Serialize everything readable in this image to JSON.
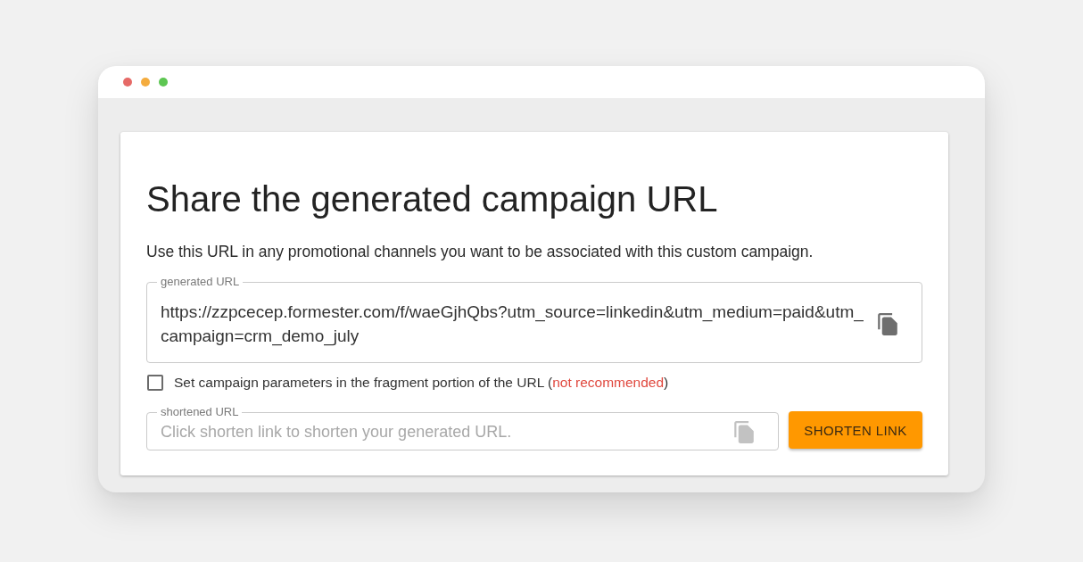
{
  "window": {
    "buttons": [
      {
        "color": "#e66a67"
      },
      {
        "color": "#f4ac3f"
      },
      {
        "color": "#5dc652"
      }
    ]
  },
  "card": {
    "title": "Share the generated campaign URL",
    "description": "Use this URL in any promotional channels you want to be associated with this custom campaign.",
    "generated_url": {
      "label": "generated URL",
      "value": "https://zzpcecep.formester.com/f/waeGjhQbs?utm_source=linkedin&utm_medium=paid&utm_campaign=crm_demo_july",
      "copy_button": {
        "disabled": false
      }
    },
    "fragment_option": {
      "checked": false,
      "text_before": "Set campaign parameters in the fragment portion of the URL (",
      "warning": "not recommended",
      "text_after": ")"
    },
    "shortened_url": {
      "label": "shortened URL",
      "placeholder": "Click shorten link to shorten your generated URL.",
      "copy_button": {
        "disabled": true
      }
    },
    "shorten_button": {
      "label": "SHORTEN LINK"
    }
  }
}
